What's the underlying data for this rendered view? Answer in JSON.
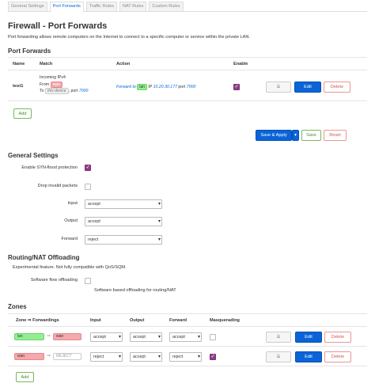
{
  "tabs": [
    "General Settings",
    "Port Forwards",
    "Traffic Rules",
    "NAT Rules",
    "Custom Rules"
  ],
  "page_title": "Firewall - Port Forwards",
  "page_description": "Port forwarding allows remote computers on the Internet to connect to a specific computer or service within the private LAN.",
  "port_forwards": {
    "title": "Port Forwards",
    "headers": {
      "name": "Name",
      "match": "Match",
      "action": "Action",
      "enable": "Enable"
    },
    "rule": {
      "name": "test1",
      "match_line1": "Incoming IPv4",
      "from_label": "From",
      "from_zone": "wan",
      "to_label": "To",
      "to_device": "this device",
      "port_label": ", port",
      "port": "7000",
      "action_forward": "Forward",
      "action_to": "to",
      "action_zone": "lan",
      "action_ip_label": "IP",
      "action_ip": "10.20.30.177",
      "action_port_label": "port",
      "action_port": "7000",
      "enabled": true
    },
    "drag_label": "☰",
    "edit_label": "Edit",
    "delete_label": "Delete",
    "add_label": "Add"
  },
  "footer_buttons": {
    "save_apply": "Save & Apply",
    "save": "Save",
    "reset": "Reset"
  },
  "general_settings": {
    "title": "General Settings",
    "syn_flood_label": "Enable SYN-flood protection",
    "syn_flood": true,
    "drop_invalid_label": "Drop invalid packets",
    "drop_invalid": false,
    "input_label": "Input",
    "input_value": "accept",
    "output_label": "Output",
    "output_value": "accept",
    "forward_label": "Forward",
    "forward_value": "reject"
  },
  "offloading": {
    "title": "Routing/NAT Offloading",
    "description": "Experimental feature. Not fully compatible with QoS/SQM.",
    "sw_label": "Software flow offloading",
    "sw_value": false,
    "sw_help": "Software based offloading for routing/NAT"
  },
  "zones": {
    "title": "Zones",
    "headers": {
      "zone": "Zone ⇒ Forwardings",
      "input": "Input",
      "output": "Output",
      "forward": "Forward",
      "masq": "Masquerading"
    },
    "rows": [
      {
        "zone": "lan",
        "arrow": "⇒",
        "target": "wan",
        "input": "accept",
        "output": "accept",
        "forward": "accept",
        "masq": false
      },
      {
        "zone": "wan",
        "arrow": "⇒",
        "target": "REJECT",
        "input": "reject",
        "output": "accept",
        "forward": "reject",
        "masq": true
      }
    ],
    "drag_label": "☰",
    "edit_label": "Edit",
    "delete_label": "Delete",
    "add_label": "Add"
  },
  "colors": {
    "primary": "#0a64d6",
    "checked": "#8e3e88",
    "lan": "#90f090",
    "wan": "#f3a9ad"
  }
}
